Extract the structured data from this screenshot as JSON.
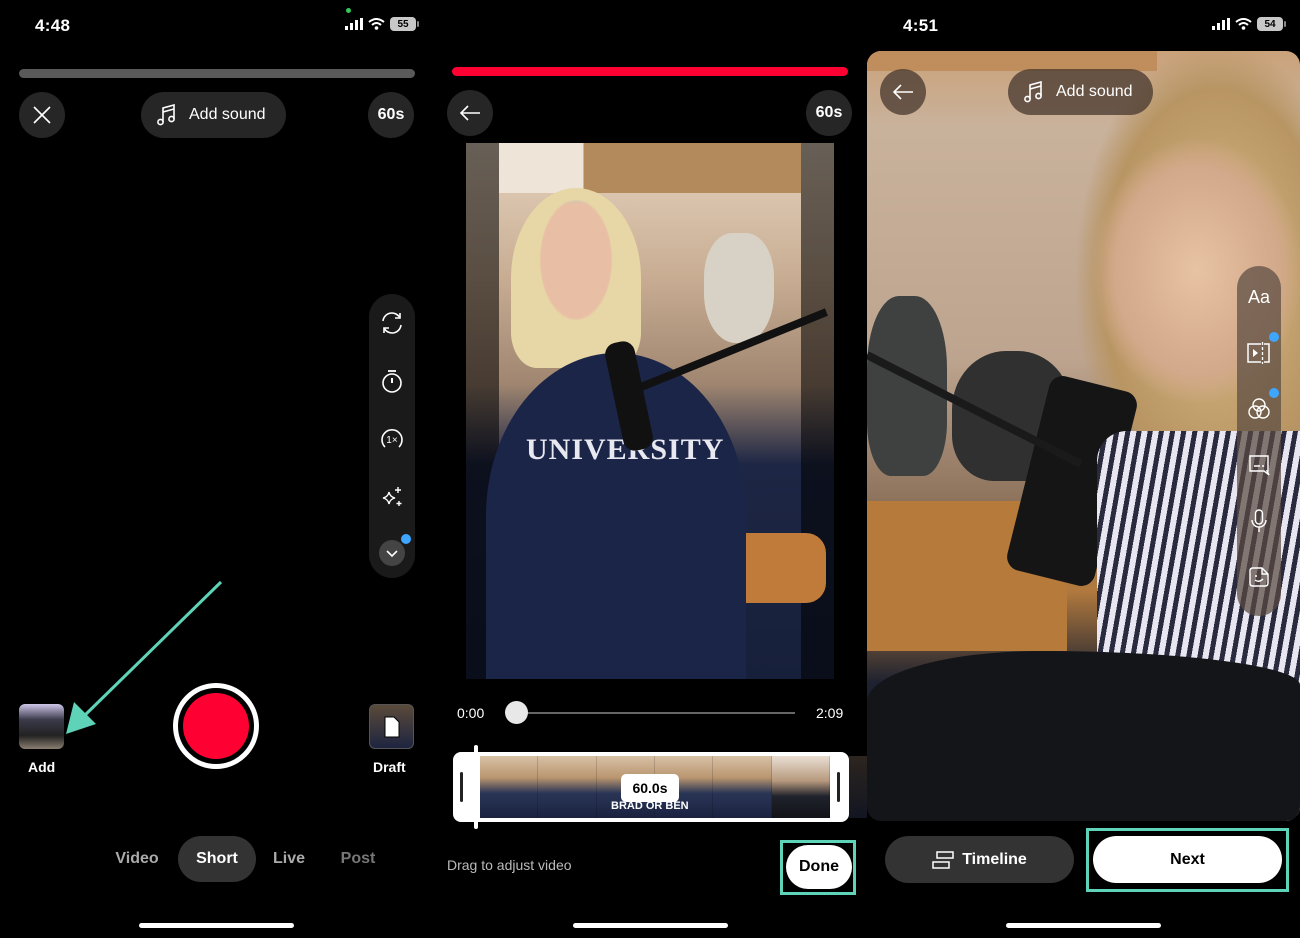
{
  "annotation_color": "#5fd3b7",
  "panel1": {
    "status": {
      "time": "4:48",
      "battery": "55"
    },
    "top_bar": {
      "close_icon": "close-icon",
      "add_sound": "Add sound",
      "duration": "60s"
    },
    "progress_percent": 0,
    "side_tools": [
      "flip-camera-icon",
      "timer-icon",
      "speed-1x-icon",
      "effects-sparkle-icon",
      "expand-chevron-icon"
    ],
    "add_label": "Add",
    "draft_label": "Draft",
    "record_color": "#ff0033",
    "modes": [
      {
        "label": "Video",
        "active": false
      },
      {
        "label": "Short",
        "active": true
      },
      {
        "label": "Live",
        "active": false
      },
      {
        "label": "Post",
        "active": false
      }
    ]
  },
  "panel2": {
    "progress_percent": 100,
    "progress_color": "#ff0033",
    "duration": "60s",
    "video_caption_text": "UNIVERSITY",
    "scrubber": {
      "start": "0:00",
      "end": "2:09",
      "position_fraction": 0
    },
    "selection_duration": "60.0s",
    "strip_watermark": "BRAD OR BEN",
    "hint": "Drag to adjust video",
    "done_label": "Done"
  },
  "panel3": {
    "status": {
      "time": "4:51",
      "battery": "54"
    },
    "add_sound": "Add sound",
    "side_tools": [
      {
        "icon": "text-aa-icon",
        "label": "Aa",
        "badge": false
      },
      {
        "icon": "trim-clip-icon",
        "badge": true
      },
      {
        "icon": "filters-icon",
        "badge": true
      },
      {
        "icon": "caption-icon",
        "badge": false
      },
      {
        "icon": "voiceover-mic-icon",
        "badge": false
      },
      {
        "icon": "sticker-icon",
        "badge": false
      }
    ],
    "timeline_label": "Timeline",
    "next_label": "Next"
  }
}
